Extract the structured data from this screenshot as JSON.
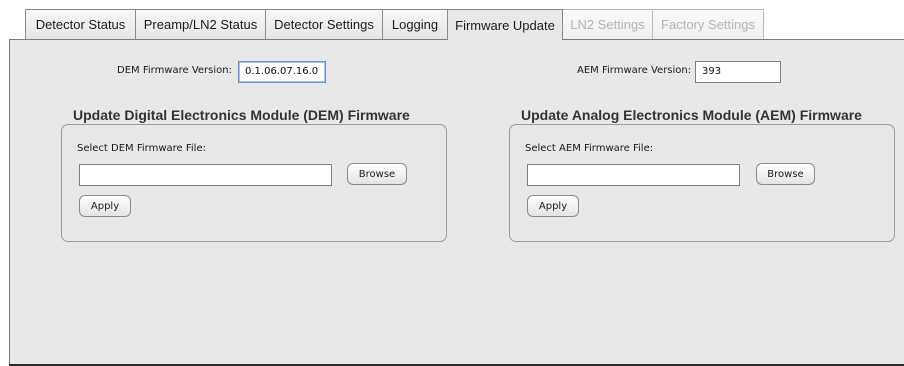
{
  "tabs": [
    {
      "label": "Detector Status",
      "state": "normal"
    },
    {
      "label": "Preamp/LN2 Status",
      "state": "normal"
    },
    {
      "label": "Detector Settings",
      "state": "normal"
    },
    {
      "label": "Logging",
      "state": "normal"
    },
    {
      "label": "Firmware Update",
      "state": "selected"
    },
    {
      "label": "LN2 Settings",
      "state": "disabled"
    },
    {
      "label": "Factory Settings",
      "state": "disabled"
    }
  ],
  "dem": {
    "version_label": "DEM Firmware Version:",
    "version_value": "0.1.06.07.16.0",
    "section_title": "Update Digital Electronics Module (DEM) Firmware",
    "file_label": "Select DEM Firmware File:",
    "file_value": "",
    "browse_label": "Browse",
    "apply_label": "Apply"
  },
  "aem": {
    "version_label": "AEM Firmware Version:",
    "version_value": "393",
    "section_title": "Update Analog Electronics Module (AEM) Firmware",
    "file_label": "Select AEM Firmware File:",
    "file_value": "",
    "browse_label": "Browse",
    "apply_label": "Apply"
  }
}
